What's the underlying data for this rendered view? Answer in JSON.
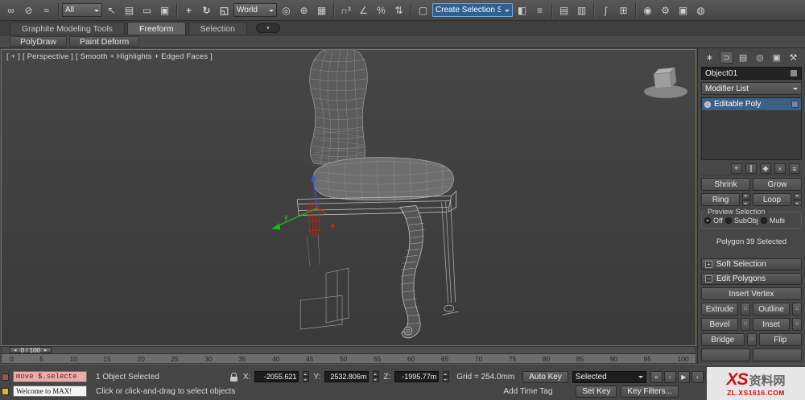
{
  "toolbar": {
    "g1": [
      {
        "name": "select-and-link-icon",
        "glyph": "∞"
      },
      {
        "name": "unlink-selection-icon",
        "glyph": "⊘"
      },
      {
        "name": "bind-to-spacewarp-icon",
        "glyph": "≈"
      }
    ],
    "selection_filter": "All",
    "g2": [
      {
        "name": "select-object-icon",
        "glyph": "↖"
      },
      {
        "name": "select-by-name-icon",
        "glyph": "▤"
      },
      {
        "name": "rectangular-selection-region-icon",
        "glyph": "▭"
      },
      {
        "name": "window-crossing-icon",
        "glyph": "▣"
      }
    ],
    "g3": [
      {
        "name": "select-and-move-icon",
        "glyph": "+"
      },
      {
        "name": "select-and-rotate-icon",
        "glyph": "↻"
      },
      {
        "name": "select-and-scale-icon",
        "glyph": "◱"
      }
    ],
    "coord_system": "World",
    "g4": [
      {
        "name": "use-pivot-center-icon",
        "glyph": "◎"
      },
      {
        "name": "select-and-manipulate-icon",
        "glyph": "⊕"
      },
      {
        "name": "keyboard-override-icon",
        "glyph": "▦"
      }
    ],
    "g5": [
      {
        "name": "snap-toggle-icon",
        "glyph": "∩³"
      },
      {
        "name": "angle-snap-icon",
        "glyph": "∠"
      },
      {
        "name": "percent-snap-icon",
        "glyph": "%"
      },
      {
        "name": "spinner-snap-icon",
        "glyph": "⇅"
      }
    ],
    "g6": [
      {
        "name": "named-selection-sets-icon",
        "glyph": "▢"
      }
    ],
    "named_selection": "Create Selection Se",
    "g7": [
      {
        "name": "mirror-icon",
        "glyph": "◧"
      },
      {
        "name": "align-icon",
        "glyph": "≡"
      }
    ],
    "g8": [
      {
        "name": "layer-manager-icon",
        "glyph": "▤"
      },
      {
        "name": "ribbon-toggle-icon",
        "glyph": "▥"
      }
    ],
    "g9": [
      {
        "name": "curve-editor-icon",
        "glyph": "ʃ"
      },
      {
        "name": "schematic-view-icon",
        "glyph": "⊞"
      }
    ],
    "g10": [
      {
        "name": "material-editor-icon",
        "glyph": "◉"
      },
      {
        "name": "render-setup-icon",
        "glyph": "⚙"
      },
      {
        "name": "rendered-frame-icon",
        "glyph": "▣"
      },
      {
        "name": "render-production-icon",
        "glyph": "◍"
      }
    ]
  },
  "ribbon": {
    "tabs": [
      "Graphite Modeling Tools",
      "Freeform",
      "Selection"
    ],
    "subtabs": [
      "PolyDraw",
      "Paint Deform"
    ],
    "pill_glyph": "▾"
  },
  "viewport": {
    "label": "[ + ] [ Perspective ] [ Smooth + Highlights + Edged Faces ]",
    "gizmo_label_y": "y"
  },
  "command_panel": {
    "tabs": [
      {
        "glyph": "∗"
      },
      {
        "glyph": "⊃"
      },
      {
        "glyph": "▤"
      },
      {
        "glyph": "◎"
      },
      {
        "glyph": "▣"
      },
      {
        "glyph": "⚒"
      }
    ],
    "object_name": "Object01",
    "modifier_list": "Modifier List",
    "stack_item": "Editable Poly",
    "stack_tools": [
      {
        "name": "pin-stack-icon",
        "glyph": "⌖"
      },
      {
        "name": "show-end-result-icon",
        "glyph": "∥"
      },
      {
        "name": "make-unique-icon",
        "glyph": "◆"
      },
      {
        "name": "remove-modifier-icon",
        "glyph": "×"
      },
      {
        "name": "configure-modifier-sets-icon",
        "glyph": "≡"
      }
    ],
    "shrink": "Shrink",
    "grow": "Grow",
    "ring": "Ring",
    "loop": "Loop",
    "preview": {
      "title": "Preview Selection",
      "off": "Off",
      "subobj": "SubObj",
      "multi": "Multi",
      "selected": "Off"
    },
    "poly_status": "Polygon 39 Selected",
    "soft_selection": "Soft Selection",
    "edit_polygons": "Edit Polygons",
    "insert_vertex": "Insert Vertex",
    "extrude": "Extrude",
    "outline": "Outline",
    "bevel": "Bevel",
    "inset": "Inset",
    "bridge": "Bridge",
    "flip": "Flip"
  },
  "timeline": {
    "slider": "0 / 100",
    "left_arrow": "◂",
    "right_arrow": "▸",
    "ticks": [
      "0",
      "5",
      "10",
      "15",
      "20",
      "25",
      "30",
      "35",
      "40",
      "45",
      "50",
      "55",
      "60",
      "65",
      "70",
      "75",
      "80",
      "85",
      "90",
      "95",
      "100"
    ]
  },
  "status_bar": {
    "listener_line1": "move $.selecte",
    "listener_line2": "Welcome to MAX!",
    "selection_status": "1 Object Selected",
    "prompt": "Click or click-and-drag to select objects",
    "add_time_tag": "Add Time Tag",
    "x_label": "X:",
    "x_value": "-2055.621",
    "y_label": "Y:",
    "y_value": "2532.806m",
    "z_label": "Z:",
    "z_value": "-1995.77m",
    "grid": "Grid = 254.0mm",
    "auto_key": "Auto Key",
    "set_key": "Set Key",
    "selected_dropdown": "Selected",
    "key_filters": "Key Filters...",
    "playback": [
      {
        "name": "go-to-start-button",
        "glyph": "«"
      },
      {
        "name": "previous-frame-button",
        "glyph": "‹"
      },
      {
        "name": "play-button",
        "glyph": "▶"
      },
      {
        "name": "next-frame-button",
        "glyph": "›"
      },
      {
        "name": "go-to-end-button",
        "glyph": "»"
      }
    ]
  },
  "watermark": {
    "xs": "XS",
    "cn": "资料网",
    "url": "ZL.XS1616.COM"
  }
}
